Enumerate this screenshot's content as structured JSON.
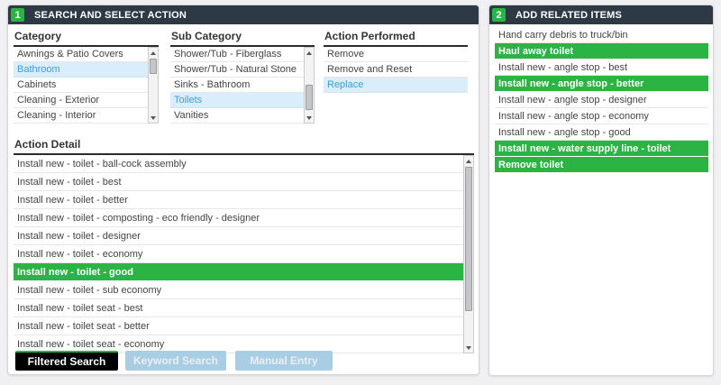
{
  "colors": {
    "accent_green": "#2bb343",
    "header_bg": "#2d3a45",
    "selected_blue_bg": "#d9eefa",
    "selected_blue_text": "#3d9fd6",
    "inactive_button_bg": "#a9cee3",
    "active_button_bg": "#000000"
  },
  "left_panel": {
    "step": "1",
    "title": "SEARCH AND SELECT ACTION",
    "category": {
      "label": "Category",
      "items": [
        {
          "label": "Awnings & Patio Covers",
          "state": "normal"
        },
        {
          "label": "Bathroom",
          "state": "selected-blue"
        },
        {
          "label": "Cabinets",
          "state": "normal"
        },
        {
          "label": "Cleaning - Exterior",
          "state": "normal"
        },
        {
          "label": "Cleaning - Interior",
          "state": "normal"
        }
      ]
    },
    "sub_category": {
      "label": "Sub Category",
      "items": [
        {
          "label": "Shower/Tub - Fiberglass",
          "state": "normal"
        },
        {
          "label": "Shower/Tub - Natural Stone",
          "state": "normal"
        },
        {
          "label": "Sinks - Bathroom",
          "state": "normal"
        },
        {
          "label": "Toilets",
          "state": "selected-blue"
        },
        {
          "label": "Vanities",
          "state": "normal"
        }
      ]
    },
    "action_performed": {
      "label": "Action Performed",
      "items": [
        {
          "label": "Remove",
          "state": "normal"
        },
        {
          "label": "Remove and Reset",
          "state": "normal"
        },
        {
          "label": "Replace",
          "state": "selected-blue"
        }
      ]
    },
    "action_detail": {
      "label": "Action Detail",
      "items": [
        {
          "label": "Install new - toilet - ball-cock assembly",
          "state": "normal"
        },
        {
          "label": "Install new - toilet - best",
          "state": "normal"
        },
        {
          "label": "Install new - toilet - better",
          "state": "normal"
        },
        {
          "label": "Install new - toilet - composting - eco friendly - designer",
          "state": "normal"
        },
        {
          "label": "Install new - toilet - designer",
          "state": "normal"
        },
        {
          "label": "Install new - toilet - economy",
          "state": "normal"
        },
        {
          "label": "Install new - toilet - good",
          "state": "selected-green"
        },
        {
          "label": "Install new - toilet - sub economy",
          "state": "normal"
        },
        {
          "label": "Install new - toilet seat - best",
          "state": "normal"
        },
        {
          "label": "Install new - toilet seat - better",
          "state": "normal"
        },
        {
          "label": "Install new - toilet seat - economy",
          "state": "normal"
        }
      ]
    },
    "buttons": [
      {
        "label": "Filtered Search",
        "style": "active"
      },
      {
        "label": "Keyword Search",
        "style": "inactive"
      },
      {
        "label": "Manual Entry",
        "style": "inactive"
      }
    ]
  },
  "right_panel": {
    "step": "2",
    "title": "ADD RELATED ITEMS",
    "items": [
      {
        "label": "Hand carry debris to truck/bin",
        "state": "normal"
      },
      {
        "label": "Haul away toilet",
        "state": "selected-green"
      },
      {
        "label": "Install new - angle stop - best",
        "state": "normal"
      },
      {
        "label": "Install new - angle stop - better",
        "state": "selected-green"
      },
      {
        "label": "Install new - angle stop - designer",
        "state": "normal"
      },
      {
        "label": "Install new - angle stop - economy",
        "state": "normal"
      },
      {
        "label": "Install new - angle stop - good",
        "state": "normal"
      },
      {
        "label": "Install new - water supply line - toilet",
        "state": "selected-green"
      },
      {
        "label": "Remove toilet",
        "state": "selected-green"
      }
    ]
  }
}
